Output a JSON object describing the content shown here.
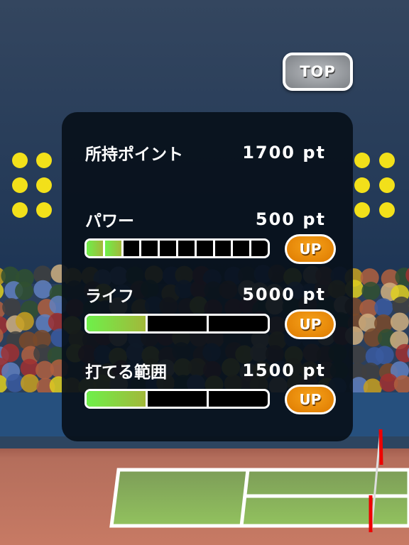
{
  "top_button": {
    "label": "TOP"
  },
  "points": {
    "label": "所持ポイント",
    "value": "1700 pt"
  },
  "upgrades": [
    {
      "label": "パワー",
      "cost": "500 pt",
      "level": 2,
      "max": 10,
      "button": "UP"
    },
    {
      "label": "ライフ",
      "cost": "5000 pt",
      "level": 1,
      "max": 3,
      "button": "UP"
    },
    {
      "label": "打てる範囲",
      "cost": "1500 pt",
      "level": 1,
      "max": 3,
      "button": "UP"
    }
  ],
  "colors": {
    "accent": "#f29400",
    "bar_fill": "#6ef04a",
    "court": "#8bbd5c",
    "ground": "#c47864"
  }
}
